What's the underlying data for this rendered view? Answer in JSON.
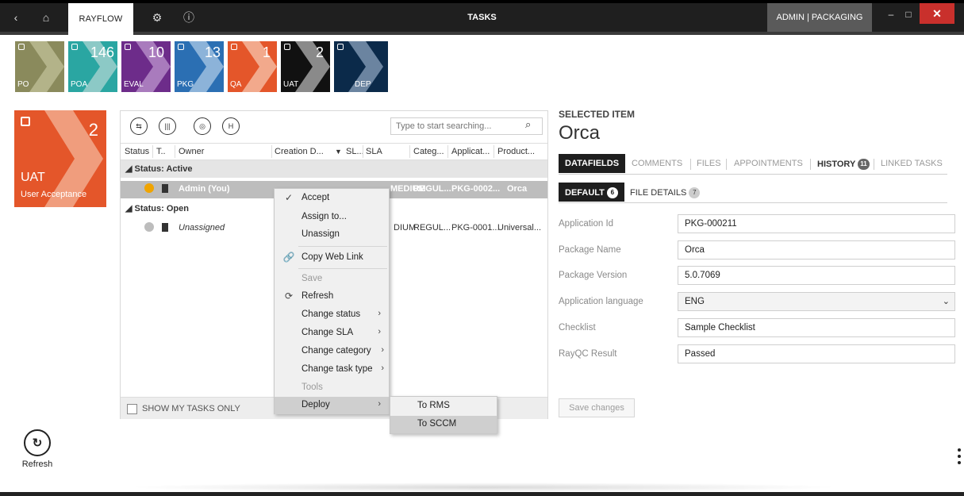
{
  "window": {
    "app_name": "RAYFLOW",
    "title": "TASKS",
    "user": "ADMIN | PACKAGING",
    "back_glyph": "‹",
    "home_glyph": "⌂",
    "settings_glyph": "⚙",
    "info_glyph": "ⓘ",
    "minimize_glyph": "–",
    "maximize_glyph": "□",
    "close_glyph": "✕"
  },
  "stages": [
    {
      "label": "PO",
      "count": "",
      "color": "#8a8a5c",
      "arrow": "#b3b389"
    },
    {
      "label": "POA",
      "count": "146",
      "color": "#2aa6a2",
      "arrow": "#8cc9c6"
    },
    {
      "label": "EVAL",
      "count": "10",
      "color": "#6d2c8a",
      "arrow": "#a97bbd"
    },
    {
      "label": "PKG",
      "count": "13",
      "color": "#2b6fb3",
      "arrow": "#8cb3d9"
    },
    {
      "label": "QA",
      "count": "1",
      "color": "#e4562a",
      "arrow": "#f2a98c"
    },
    {
      "label": "UAT",
      "count": "2",
      "color": "#111111",
      "arrow": "#8a8a8a"
    },
    {
      "label": "DEP",
      "count": "",
      "color": "#0b2a4a",
      "arrow": "#6b84a0"
    }
  ],
  "current_stage": {
    "count": "2",
    "name": "UAT",
    "subtitle": "User Acceptance"
  },
  "grid": {
    "search_placeholder": "Type to start searching...",
    "search_glyph": "⌕",
    "toolbar_glyphs": [
      "⇆",
      "|||",
      "◎",
      "H"
    ],
    "columns": [
      "Status",
      "T..",
      "Owner",
      "Creation D...",
      "SL...",
      "SLA",
      "Categ...",
      "Applicat...",
      "Product..."
    ],
    "sort_glyph": "▼",
    "groups": [
      {
        "label": "◢ Status: Active"
      },
      {
        "label": "◢ Status: Open"
      }
    ],
    "rows": [
      {
        "owner": "Admin (You)",
        "sla": "MEDIUM",
        "category": "REGUL...",
        "application": "PKG-0002...",
        "product": "Orca"
      },
      {
        "owner": "Unassigned",
        "sla": "DIUM",
        "category": "REGUL...",
        "application": "PKG-0001...",
        "product": "Universal..."
      }
    ],
    "show_my_tasks_label": "SHOW MY TASKS ONLY"
  },
  "context_menu": {
    "items": [
      {
        "label": "Accept",
        "icon": "✓"
      },
      {
        "label": "Assign to..."
      },
      {
        "label": "Unassign"
      },
      {
        "label": "Copy Web Link",
        "icon": "🔗"
      },
      {
        "label": "Save"
      },
      {
        "label": "Refresh",
        "icon": "⟳"
      },
      {
        "label": "Change status"
      },
      {
        "label": "Change SLA"
      },
      {
        "label": "Change category"
      },
      {
        "label": "Change task type"
      },
      {
        "label": "Tools"
      },
      {
        "label": "Deploy"
      }
    ],
    "submenu_glyph": "›",
    "submenu": [
      "To RMS",
      "To SCCM"
    ]
  },
  "detail": {
    "section_label": "SELECTED ITEM",
    "title": "Orca",
    "tabs": [
      {
        "label": "DATAFIELDS"
      },
      {
        "label": "COMMENTS"
      },
      {
        "label": "FILES"
      },
      {
        "label": "APPOINTMENTS"
      },
      {
        "label": "HISTORY",
        "badge": "11"
      },
      {
        "label": "LINKED TASKS"
      }
    ],
    "subtabs": [
      {
        "label": "DEFAULT",
        "badge": "6"
      },
      {
        "label": "FILE DETAILS",
        "badge": "7"
      }
    ],
    "fields": [
      {
        "label": "Application Id",
        "value": "PKG-000211"
      },
      {
        "label": "Package Name",
        "value": "Orca"
      },
      {
        "label": "Package Version",
        "value": "5.0.7069"
      },
      {
        "label": "Application language",
        "value": "ENG"
      },
      {
        "label": "Checklist",
        "value": "Sample Checklist"
      },
      {
        "label": "RayQC Result",
        "value": "Passed"
      }
    ],
    "dropdown_glyph": "⌄",
    "save_label": "Save changes"
  },
  "sidebar": {
    "refresh_label": "Refresh"
  }
}
